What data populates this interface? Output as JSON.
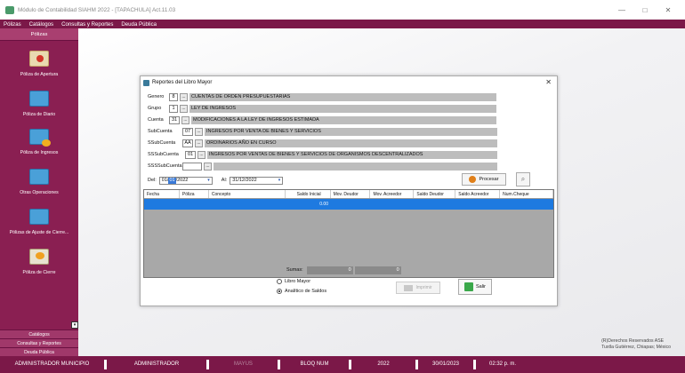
{
  "window": {
    "title": "Módulo de Contabilidad SIAHM 2022 - [TAPACHULA] Act.11.03",
    "minimize": "—",
    "maximize": "□",
    "close": "✕"
  },
  "menu": [
    "Pólizas",
    "Catálogos",
    "Consultas y Reportes",
    "Deuda Pública"
  ],
  "sidebar": {
    "header": "Pólizas",
    "items": [
      {
        "label": "Póliza de Apertura",
        "icon": "apertura-icon"
      },
      {
        "label": "Póliza de Diario",
        "icon": "diario-icon"
      },
      {
        "label": "Póliza de Ingresos",
        "icon": "ingresos-icon"
      },
      {
        "label": "Otras Operaciones",
        "icon": "otras-icon"
      },
      {
        "label": "Pólizas de Ajuste de Cierre...",
        "icon": "ajuste-icon"
      },
      {
        "label": "Póliza de Cierre",
        "icon": "cierre-icon"
      }
    ],
    "bottom": [
      "Catálogos",
      "Consultas y Reportes",
      "Deuda Pública"
    ]
  },
  "copyright": {
    "line1": "(R)Derechos Reservados ASE",
    "line2": "Tuxtla Gutiérrez, Chiapas; México"
  },
  "status": {
    "items": [
      "ADMINISTRADOR MUNICIPIO",
      "ADMINISTRADOR",
      "MAYUS",
      "BLOQ NUM",
      "2022",
      "30/01/2023",
      "02:32 p. m."
    ]
  },
  "dialog": {
    "title": "Reportes del Libro Mayor",
    "close": "✕",
    "fields": [
      {
        "label": "Genero",
        "code": "8",
        "desc": "CUENTAS DE ORDEN PRESUPUESTARIAS"
      },
      {
        "label": "Grupo",
        "code": "1",
        "desc": "LEY DE INGRESOS"
      },
      {
        "label": "Cuenta",
        "code": "31",
        "desc": "MODIFICACIONES A LA LEY DE INGRESOS ESTIMADA"
      },
      {
        "label": "SubCuenta",
        "code": "07",
        "desc": "INGRESOS POR VENTA DE BIENES Y SERVICIOS"
      },
      {
        "label": "SSubCuenta",
        "code": "AA",
        "desc": "ORDINARIOS AÑO EN CURSO"
      },
      {
        "label": "SSSubCuenta",
        "code": "01",
        "desc": "INGRESOS POR VENTAS DE BIENES Y SERVICIOS DE ORGANISMOS DESCENTRALIZADOS"
      },
      {
        "label": "SSSSubCuenta",
        "code": "",
        "desc": ""
      }
    ],
    "lookup": "...",
    "date_from": {
      "label": "Del:",
      "day": "01",
      "sel": "01",
      "year": "/2022"
    },
    "date_to": {
      "label": "Al:",
      "value": "31/12/2022"
    },
    "procesar": "Procesar",
    "columns": [
      "Fecha",
      "Póliza",
      "Concepto",
      "Saldo Inicial",
      "Mov. Deudor",
      "Mov. Acreedor",
      "Saldo Deudor",
      "Saldo Acreedor",
      "Num.Cheque"
    ],
    "row": {
      "saldo_inicial": "0.00"
    },
    "sumas": {
      "label": "Sumas:",
      "deudor": "0",
      "acreedor": "0"
    },
    "radios": [
      {
        "label": "Libro Mayor",
        "checked": false
      },
      {
        "label": "Analítico de Saldos",
        "checked": true
      }
    ],
    "imprimir": "Imprimir",
    "salir": "Salir"
  }
}
